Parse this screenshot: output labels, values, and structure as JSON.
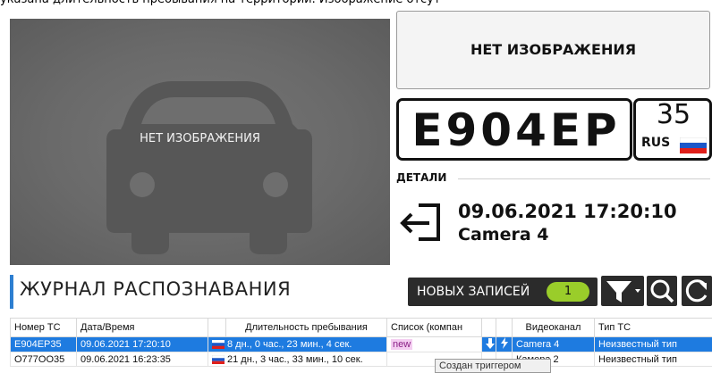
{
  "top_caption": "указана длительность пребывания на территории. Изображение отсут",
  "camera": {
    "no_image_label": "НЕТ ИЗОБРАЖЕНИЯ"
  },
  "side_panel": {
    "no_image_label": "НЕТ ИЗОБРАЖЕНИЯ"
  },
  "plate": {
    "number": "E904EP",
    "region": "35",
    "country": "RUS"
  },
  "details": {
    "label": "ДЕТАЛИ",
    "datetime": "09.06.2021 17:20:10",
    "camera": "Camera 4",
    "icon": "enter-icon"
  },
  "journal": {
    "title": "ЖУРНАЛ РАСПОЗНАВАНИЯ",
    "new_records_label": "НОВЫХ ЗАПИСЕЙ",
    "new_records_count": "1"
  },
  "toolbar_icons": [
    "filter-icon",
    "search-icon",
    "refresh-icon"
  ],
  "table": {
    "columns": [
      "Номер ТС",
      "Дата/Время",
      "",
      "Длительность пребывания",
      "Список (компан",
      "",
      "",
      "Видеоканал",
      "Тип ТС"
    ],
    "rows": [
      {
        "plate": "E904EP35",
        "datetime": "09.06.2021 17:20:10",
        "duration": "8 дн., 0 час., 23 мин., 4 сек.",
        "list": "new",
        "channel": "Camera 4",
        "type": "Неизвестный тип"
      },
      {
        "plate": "O777OO35",
        "datetime": "09.06.2021 16:23:35",
        "duration": "21 дн., 3 час., 33 мин., 10 сек.",
        "list": "",
        "channel": "Камера 2",
        "type": "Неизвестный тип"
      }
    ]
  },
  "tooltip": "Создан триггером",
  "colors": {
    "accent": "#2d7fd1",
    "selection": "#1e7be0",
    "count_badge": "#9acd2a",
    "toolbar": "#2b2b2b"
  }
}
